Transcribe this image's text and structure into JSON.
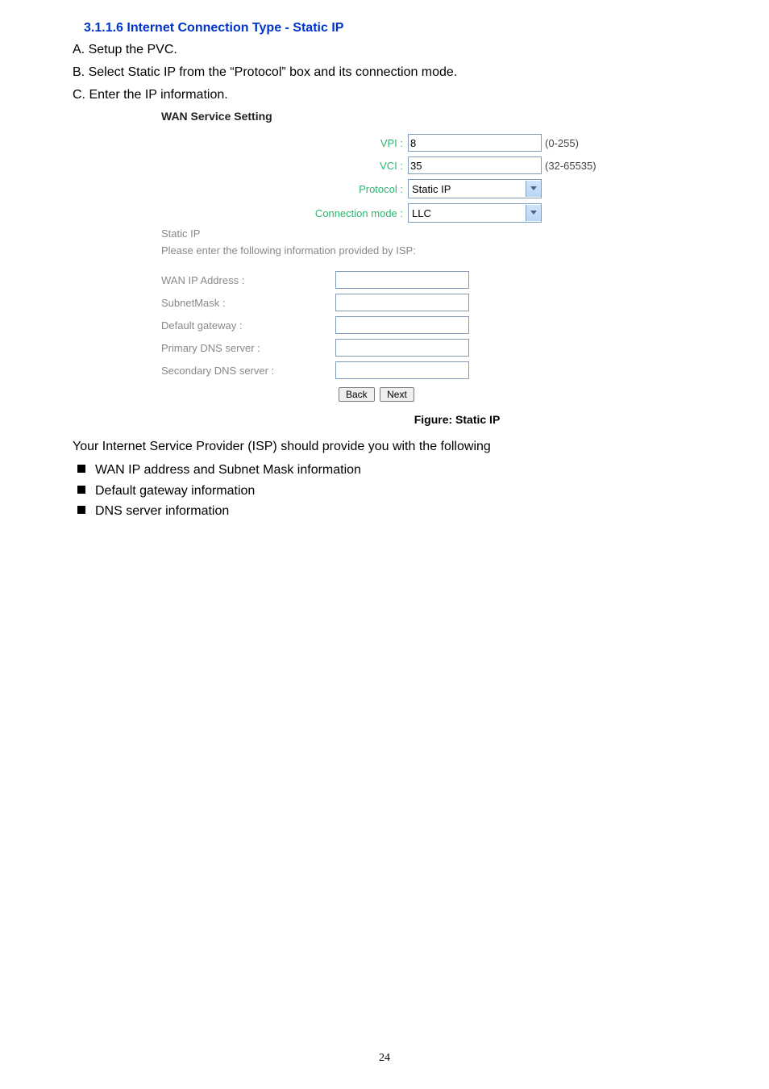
{
  "heading": "3.1.1.6 Internet Connection Type - Static IP",
  "steps": {
    "a": "A. Setup the PVC.",
    "b": "B. Select Static IP from the “Protocol” box and its connection mode.",
    "c": "C. Enter the IP information."
  },
  "panel": {
    "title": "WAN Service Setting",
    "vpi_label": "VPI :",
    "vpi_value": "8",
    "vpi_hint": "(0-255)",
    "vci_label": "VCI :",
    "vci_value": "35",
    "vci_hint": "(32-65535)",
    "protocol_label": "Protocol :",
    "protocol_value": "Static IP",
    "connmode_label": "Connection mode :",
    "connmode_value": "LLC",
    "section_label": "Static IP",
    "section_note": "Please enter the following information provided by ISP:",
    "wanip_label": "WAN IP Address :",
    "subnet_label": "SubnetMask :",
    "gateway_label": "Default gateway :",
    "dns1_label": "Primary DNS server  :",
    "dns2_label": "Secondary DNS server  :",
    "wanip_value": "",
    "subnet_value": "",
    "gateway_value": "",
    "dns1_value": "",
    "dns2_value": "",
    "back_label": "Back",
    "next_label": "Next"
  },
  "figure_caption": "Figure: Static IP",
  "after_text": "Your Internet Service Provider (ISP) should provide you with the following",
  "bullets": {
    "b1": "WAN IP address and Subnet Mask information",
    "b2": "Default gateway information",
    "b3": "DNS server information"
  },
  "page_number": "24"
}
